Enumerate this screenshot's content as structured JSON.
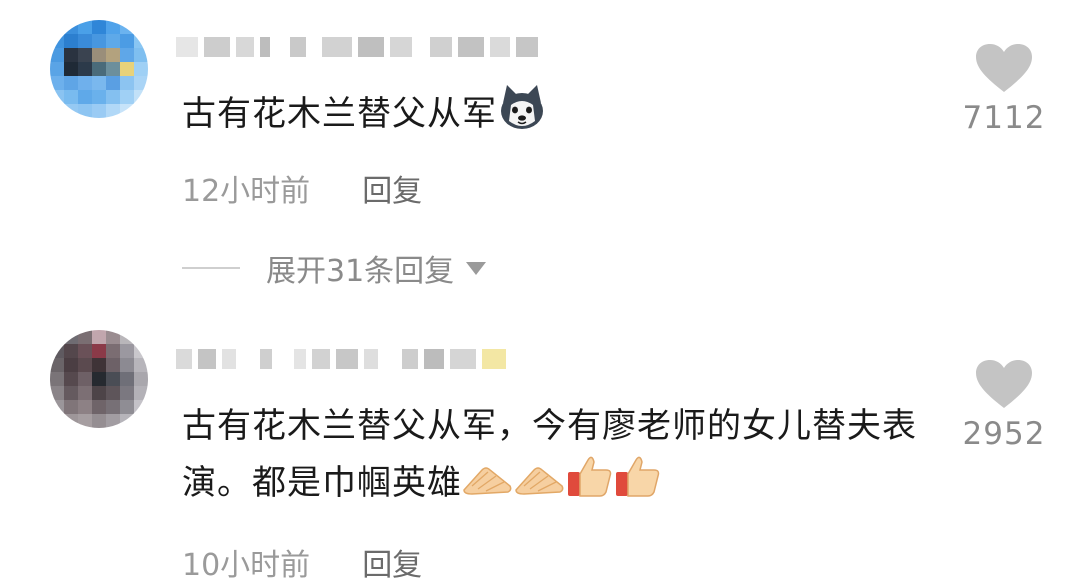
{
  "comments": [
    {
      "text": "古有花木兰替父从军",
      "time": "12小时前",
      "reply_label": "回复",
      "likes": "7112",
      "emojis": [
        "husky-dog-emoji"
      ]
    },
    {
      "text": "古有花木兰替父从军，今有廖老师的女儿替夫表演。都是巾帼英雄",
      "time": "10小时前",
      "reply_label": "回复",
      "likes": "2952",
      "emojis": [
        "clapping-hands-emoji",
        "clapping-hands-emoji",
        "thumbs-up-emoji",
        "thumbs-up-emoji"
      ]
    }
  ],
  "expand_replies_label": "展开31条回复",
  "colors": {
    "like_heart": "#c4c4c4",
    "meta_text": "#9a9a9a",
    "reply_text": "#6b6b6b"
  }
}
